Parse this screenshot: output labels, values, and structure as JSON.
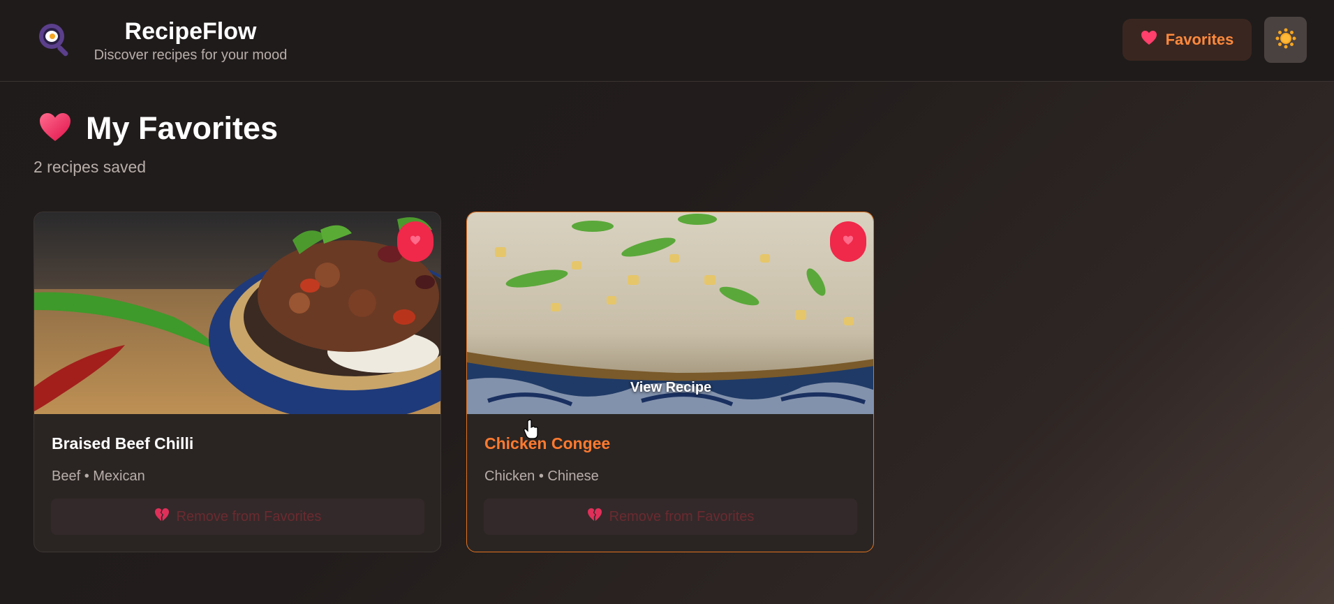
{
  "header": {
    "brand_title": "RecipeFlow",
    "brand_subtitle": "Discover recipes for your mood",
    "favorites_label": "Favorites",
    "logo_icon": "frying-pan-egg-icon",
    "theme_icon": "sun-icon"
  },
  "page": {
    "title": "My Favorites",
    "count_text": "2 recipes saved"
  },
  "cards": [
    {
      "title": "Braised Beef Chilli",
      "meta": "Beef • Mexican",
      "remove_label": "Remove from Favorites",
      "image_subject": "chilli-with-rice-in-blue-bowl"
    },
    {
      "title": "Chicken Congee",
      "meta": "Chicken • Chinese",
      "remove_label": "Remove from Favorites",
      "overlay_label": "View Recipe",
      "image_subject": "congee-with-scallions-in-blue-bowl"
    }
  ],
  "colors": {
    "accent": "#ff7a2f",
    "heart": "#f0284a",
    "background": "#1f1b1b"
  }
}
